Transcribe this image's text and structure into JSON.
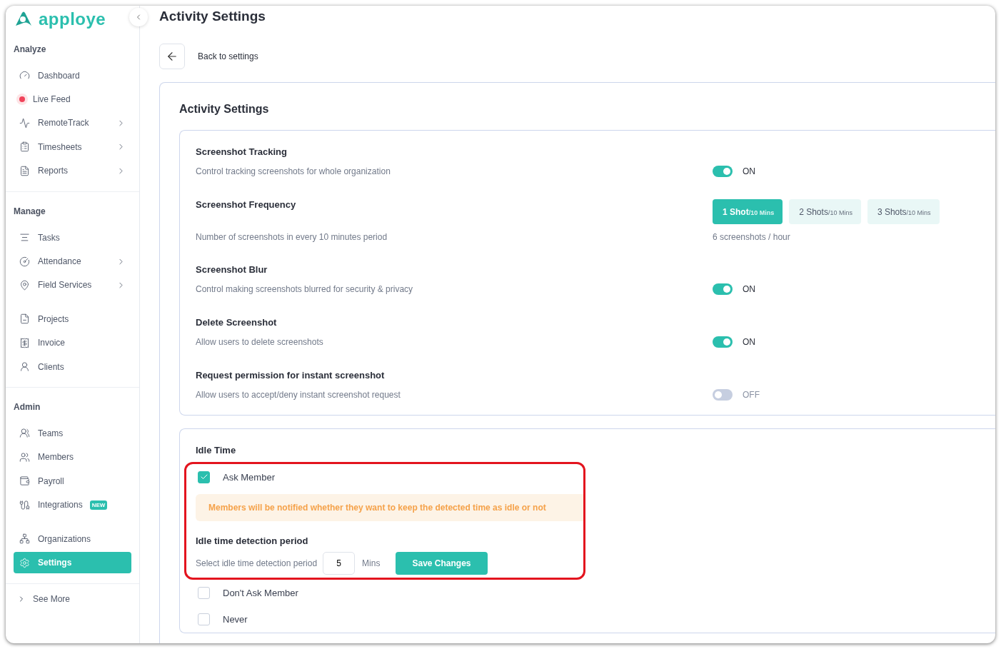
{
  "brand": {
    "name": "apploye"
  },
  "sidebar": {
    "sections": [
      {
        "heading": "Analyze",
        "groups": [
          [
            {
              "label": "Dashboard",
              "selected": false,
              "submenu": false
            },
            {
              "label": "Live Feed",
              "selected": false,
              "submenu": false
            },
            {
              "label": "RemoteTrack",
              "selected": false,
              "submenu": true
            },
            {
              "label": "Timesheets",
              "selected": false,
              "submenu": true
            },
            {
              "label": "Reports",
              "selected": false,
              "submenu": true
            }
          ]
        ]
      },
      {
        "heading": "Manage",
        "groups": [
          [
            {
              "label": "Tasks",
              "selected": false,
              "submenu": false
            },
            {
              "label": "Attendance",
              "selected": false,
              "submenu": true
            },
            {
              "label": "Field Services",
              "selected": false,
              "submenu": true
            }
          ],
          [
            {
              "label": "Projects",
              "selected": false,
              "submenu": false
            },
            {
              "label": "Invoice",
              "selected": false,
              "submenu": false
            },
            {
              "label": "Clients",
              "selected": false,
              "submenu": false
            }
          ]
        ]
      },
      {
        "heading": "Admin",
        "groups": [
          [
            {
              "label": "Teams",
              "selected": false,
              "submenu": false
            },
            {
              "label": "Members",
              "selected": false,
              "submenu": false
            },
            {
              "label": "Payroll",
              "selected": false,
              "submenu": false
            },
            {
              "label": "Integrations",
              "selected": false,
              "submenu": false,
              "badge": "NEW"
            }
          ],
          [
            {
              "label": "Organizations",
              "selected": false,
              "submenu": false
            },
            {
              "label": "Settings",
              "selected": true,
              "submenu": false
            }
          ]
        ]
      }
    ],
    "see_more": "See More"
  },
  "page": {
    "title": "Activity Settings",
    "back": "Back to settings"
  },
  "card": {
    "title": "Activity Settings",
    "rows": [
      {
        "kind": "toggle",
        "title": "Screenshot Tracking",
        "description": "Control tracking screenshots for whole organization",
        "on": true,
        "state": "ON"
      },
      {
        "kind": "choice",
        "title": "Screenshot Frequency",
        "description": "Number of screenshots in every 10 minutes period",
        "options": [
          {
            "count": "1 Shot",
            "unit": "/10 Mins",
            "selected": true
          },
          {
            "count": "2 Shots",
            "unit": "/10 Mins",
            "selected": false
          },
          {
            "count": "3 Shots",
            "unit": "/10 Mins",
            "selected": false
          }
        ],
        "note": "6 screenshots / hour"
      },
      {
        "kind": "toggle",
        "title": "Screenshot Blur",
        "description": "Control making screenshots blurred for security & privacy",
        "on": true,
        "state": "ON"
      },
      {
        "kind": "toggle",
        "title": "Delete Screenshot",
        "description": "Allow users to delete screenshots",
        "on": true,
        "state": "ON"
      },
      {
        "kind": "toggle",
        "title": "Request permission for instant screenshot",
        "description": "Allow users to accept/deny instant screenshot request",
        "on": false,
        "state": "OFF"
      }
    ]
  },
  "idle_time": {
    "title": "Idle Time",
    "options": [
      {
        "label": "Ask Member",
        "checked": true,
        "highlighted": true,
        "note": "Members will be notified whether they want to keep the detected time as idle or not",
        "period": {
          "title": "Idle time detection period",
          "label": "Select idle time detection period",
          "value": "5",
          "unit": "Mins",
          "button": "Save Changes"
        }
      },
      {
        "label": "Don't Ask Member",
        "checked": false,
        "highlighted": false
      },
      {
        "label": "Never",
        "checked": false,
        "highlighted": false
      }
    ]
  }
}
